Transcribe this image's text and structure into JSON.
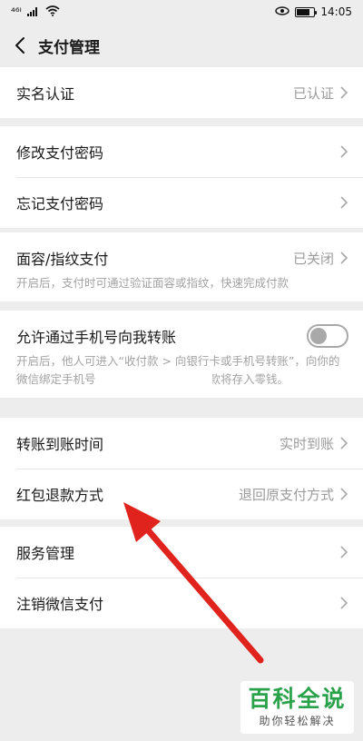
{
  "status_bar": {
    "left": "⁴⁶ᴵ",
    "time": "14:05"
  },
  "nav": {
    "title": "支付管理"
  },
  "sections": {
    "realname": {
      "label": "实名认证",
      "value": "已认证"
    },
    "password": {
      "modify": "修改支付密码",
      "forgot": "忘记支付密码"
    },
    "biometric": {
      "label": "面容/指纹支付",
      "value": "已关闭",
      "desc": "开启后，支付时可通过验证面容或指纹，快速完成付款"
    },
    "phone_transfer": {
      "label": "允许通过手机号向我转账",
      "toggle_on": false,
      "desc": "开启后，他人可进入“收付款 > 向银行卡或手机号转账”，向你的微信绑定手机号　　　　　　　账，收款将存入零钱。"
    },
    "transfer": {
      "arrival_label": "转账到账时间",
      "arrival_value": "实时到账",
      "refund_label": "红包退款方式",
      "refund_value": "退回原支付方式"
    },
    "service": {
      "manage": "服务管理",
      "cancel": "注销微信支付"
    }
  },
  "watermark": {
    "logo": "百科全说",
    "sub": "助你轻松解决"
  },
  "colors": {
    "background": "#ededed",
    "annotation_arrow": "#e0231c",
    "watermark_green": "#2aa24a"
  }
}
